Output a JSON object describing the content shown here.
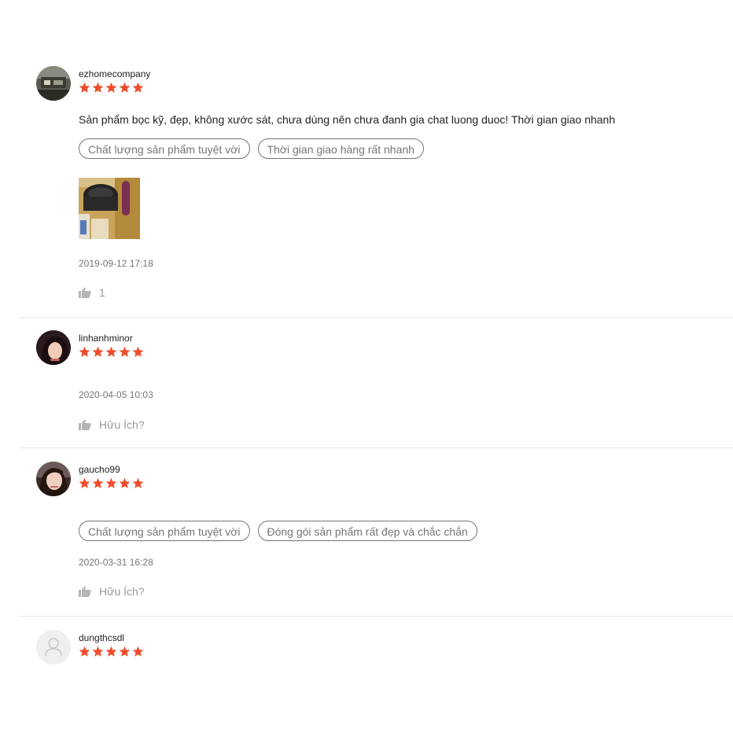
{
  "reviews": [
    {
      "username": "ezhomecompany",
      "rating": 5,
      "comment": "Sản phẩm bọc kỹ, đẹp, không xước sát, chưa dùng nên chưa đanh gia chat luong duoc! Thời gian giao nhanh",
      "tags": [
        "Chất lượng sản phẩm tuyệt vời",
        "Thời gian giao hàng rất nhanh"
      ],
      "timestamp": "2019-09-12 17:18",
      "likes": "1"
    },
    {
      "username": "linhanhminor",
      "rating": 5,
      "timestamp": "2020-04-05 10:03",
      "likes": "Hữu Ích?"
    },
    {
      "username": "gaucho99",
      "rating": 5,
      "tags": [
        "Chất lượng sản phẩm tuyệt vời",
        "Đóng gói sản phẩm rất đẹp và chắc chắn"
      ],
      "timestamp": "2020-03-31 16:28",
      "likes": "Hữu Ích?"
    },
    {
      "username": "dungthcsdl",
      "rating": 5
    }
  ],
  "colors": {
    "star": "#ee4d2d",
    "muted": "#757575",
    "divider": "#e8e8e8"
  },
  "icons": {
    "star": "star-icon",
    "like": "thumbs-up-icon",
    "default_avatar": "user-icon"
  }
}
